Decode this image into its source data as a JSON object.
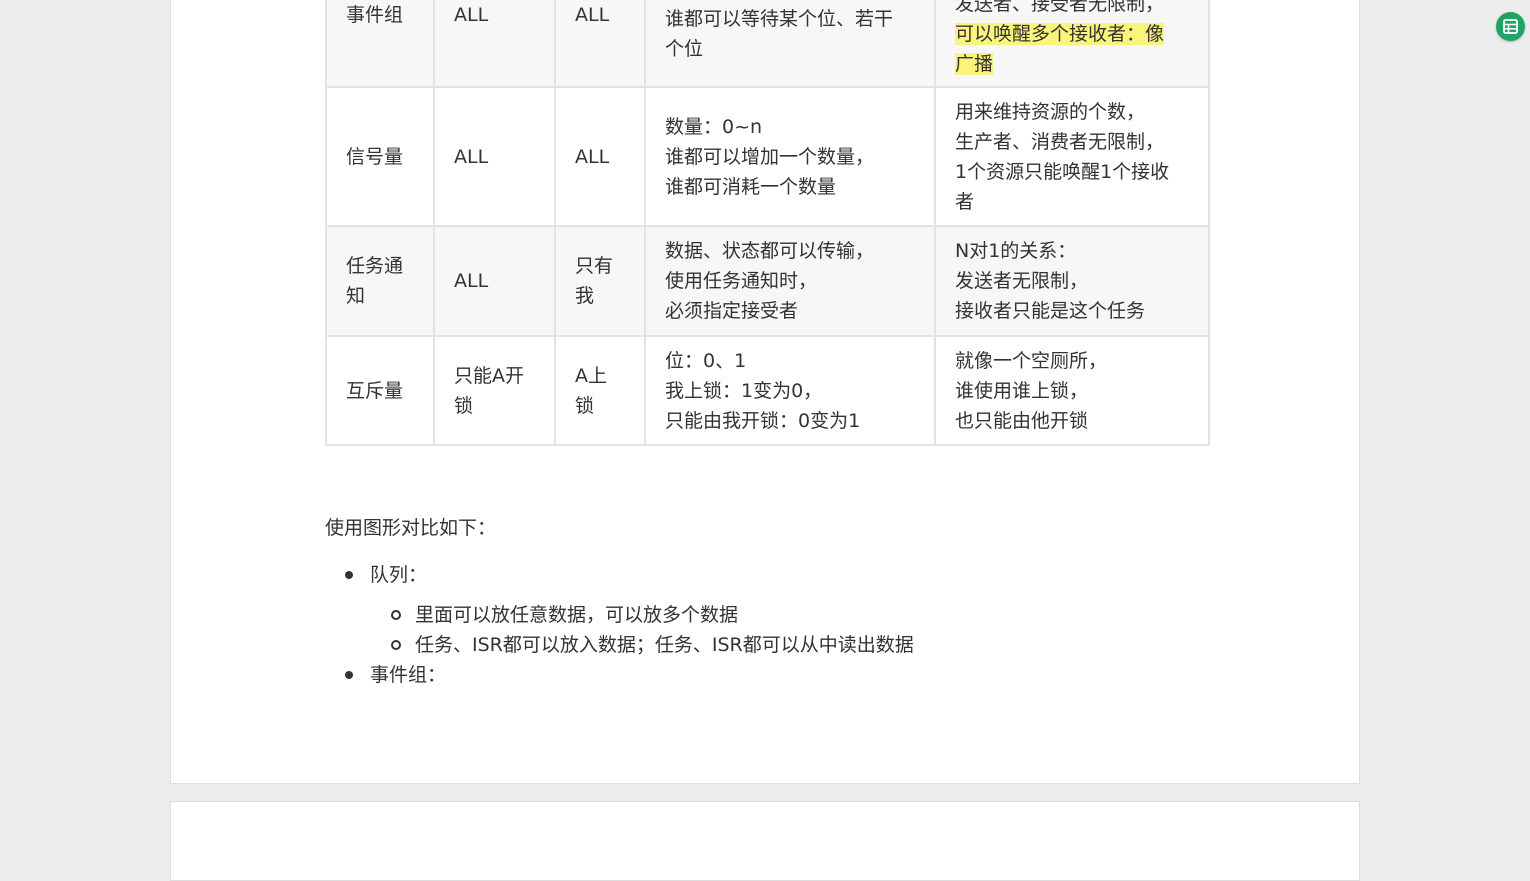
{
  "table": {
    "rows": [
      {
        "name_lines": [
          "事件组"
        ],
        "writer_lines": [
          "ALL"
        ],
        "reader_lines": [
          "ALL"
        ],
        "desc_lines": [
          "谁都可以等待某个位、若干",
          "个位"
        ],
        "note_lines": [
          "发送者、接受者无限制，"
        ],
        "note_highlight_lines": [
          "可以唤醒多个接收者：像",
          "广播"
        ]
      },
      {
        "name_lines": [
          "信号量"
        ],
        "writer_lines": [
          "ALL"
        ],
        "reader_lines": [
          "ALL"
        ],
        "desc_lines": [
          "数量：0~n",
          "谁都可以增加一个数量，",
          "谁都可消耗一个数量"
        ],
        "note_lines": [
          "用来维持资源的个数，",
          "生产者、消费者无限制，",
          "1个资源只能唤醒1个接收",
          "者"
        ],
        "note_highlight_lines": []
      },
      {
        "name_lines": [
          "任务通",
          "知"
        ],
        "writer_lines": [
          "ALL"
        ],
        "reader_lines": [
          "只有",
          "我"
        ],
        "desc_lines": [
          "数据、状态都可以传输，",
          "使用任务通知时，",
          "必须指定接受者"
        ],
        "note_lines": [
          "N对1的关系：",
          "发送者无限制，",
          "接收者只能是这个任务"
        ],
        "note_highlight_lines": []
      },
      {
        "name_lines": [
          "互斥量"
        ],
        "writer_lines": [
          "只能A开",
          "锁"
        ],
        "reader_lines": [
          "A上",
          "锁"
        ],
        "desc_lines": [
          "位：0、1",
          "我上锁：1变为0，",
          "只能由我开锁：0变为1"
        ],
        "note_lines": [
          "就像一个空厕所，",
          "谁使用谁上锁，",
          "也只能由他开锁"
        ],
        "note_highlight_lines": []
      }
    ]
  },
  "intro_text": "使用图形对比如下：",
  "list": {
    "queue_label": "队列：",
    "queue_items": [
      "里面可以放任意数据，可以放多个数据",
      "任务、ISR都可以放入数据；任务、ISR都可以从中读出数据"
    ],
    "event_group_label": "事件组："
  },
  "colors": {
    "background": "#ececec",
    "page": "#ffffff",
    "highlight": "#fbf47a",
    "sheet_icon": "#1fa463"
  },
  "icons": {
    "sheet": "spreadsheet-icon"
  }
}
